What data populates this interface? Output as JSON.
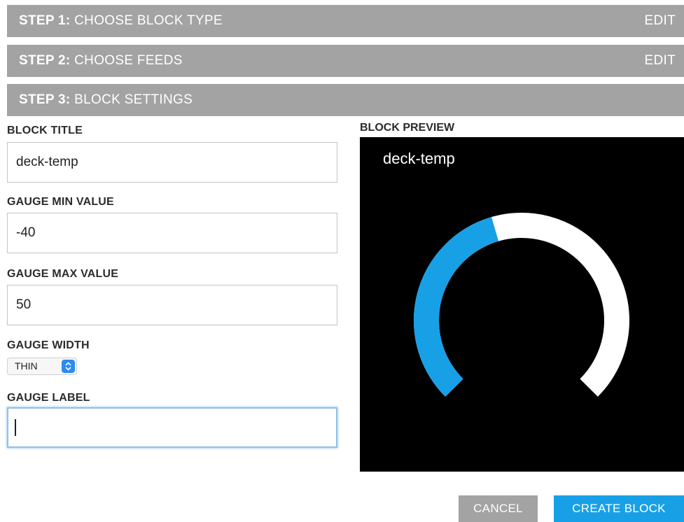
{
  "steps": [
    {
      "num": "STEP 1:",
      "title": "CHOOSE BLOCK TYPE",
      "edit": "EDIT"
    },
    {
      "num": "STEP 2:",
      "title": "CHOOSE FEEDS",
      "edit": "EDIT"
    },
    {
      "num": "STEP 3:",
      "title": "BLOCK SETTINGS"
    }
  ],
  "form": {
    "block_title_label": "BLOCK TITLE",
    "block_title_value": "deck-temp",
    "gauge_min_label": "GAUGE MIN VALUE",
    "gauge_min_value": "-40",
    "gauge_max_label": "GAUGE MAX VALUE",
    "gauge_max_value": "50",
    "gauge_width_label": "GAUGE WIDTH",
    "gauge_width_value": "THIN",
    "gauge_label_label": "GAUGE LABEL",
    "gauge_label_value": ""
  },
  "preview": {
    "label": "BLOCK PREVIEW",
    "title": "deck-temp",
    "gauge_fill_fraction": 0.44,
    "fill_color": "#18a0e6",
    "track_color": "#ffffff",
    "background_color": "#000000"
  },
  "buttons": {
    "cancel": "CANCEL",
    "create": "CREATE BLOCK"
  },
  "colors": {
    "step_bar": "#a3a3a3",
    "primary": "#18a0e6",
    "select_accent": "#2a8cf0"
  }
}
